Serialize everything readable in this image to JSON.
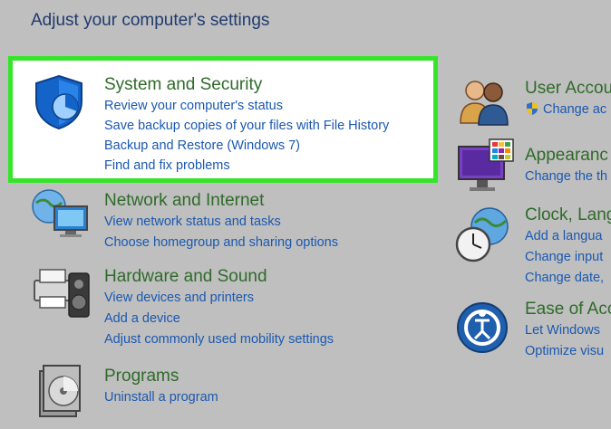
{
  "header": {
    "title": "Adjust your computer's settings"
  },
  "left": [
    {
      "title": "System and Security",
      "icon": "security-shield-icon",
      "links": [
        "Review your computer's status",
        "Save backup copies of your files with File History",
        "Backup and Restore (Windows 7)",
        "Find and fix problems"
      ]
    },
    {
      "title": "Network and Internet",
      "icon": "network-globe-icon",
      "links": [
        "View network status and tasks",
        "Choose homegroup and sharing options"
      ]
    },
    {
      "title": "Hardware and Sound",
      "icon": "printer-speaker-icon",
      "links": [
        "View devices and printers",
        "Add a device",
        "Adjust commonly used mobility settings"
      ]
    },
    {
      "title": "Programs",
      "icon": "programs-disc-icon",
      "links": [
        "Uninstall a program"
      ]
    }
  ],
  "right": [
    {
      "title": "User Accou",
      "icon": "users-icon",
      "links": [
        "Change ac"
      ]
    },
    {
      "title": "Appearanc",
      "icon": "monitor-palette-icon",
      "links": [
        "Change the th"
      ]
    },
    {
      "title": "Clock, Lang",
      "icon": "clock-globe-icon",
      "links": [
        "Add a langua",
        "Change input",
        "Change date, "
      ]
    },
    {
      "title": "Ease of Acc",
      "icon": "ease-of-access-icon",
      "links": [
        "Let Windows",
        "Optimize visu"
      ]
    }
  ],
  "colors": {
    "highlight_border": "#35e52a",
    "category_title": "#2f6b2a",
    "link": "#1a58b0",
    "background": "#bfbfbf"
  }
}
